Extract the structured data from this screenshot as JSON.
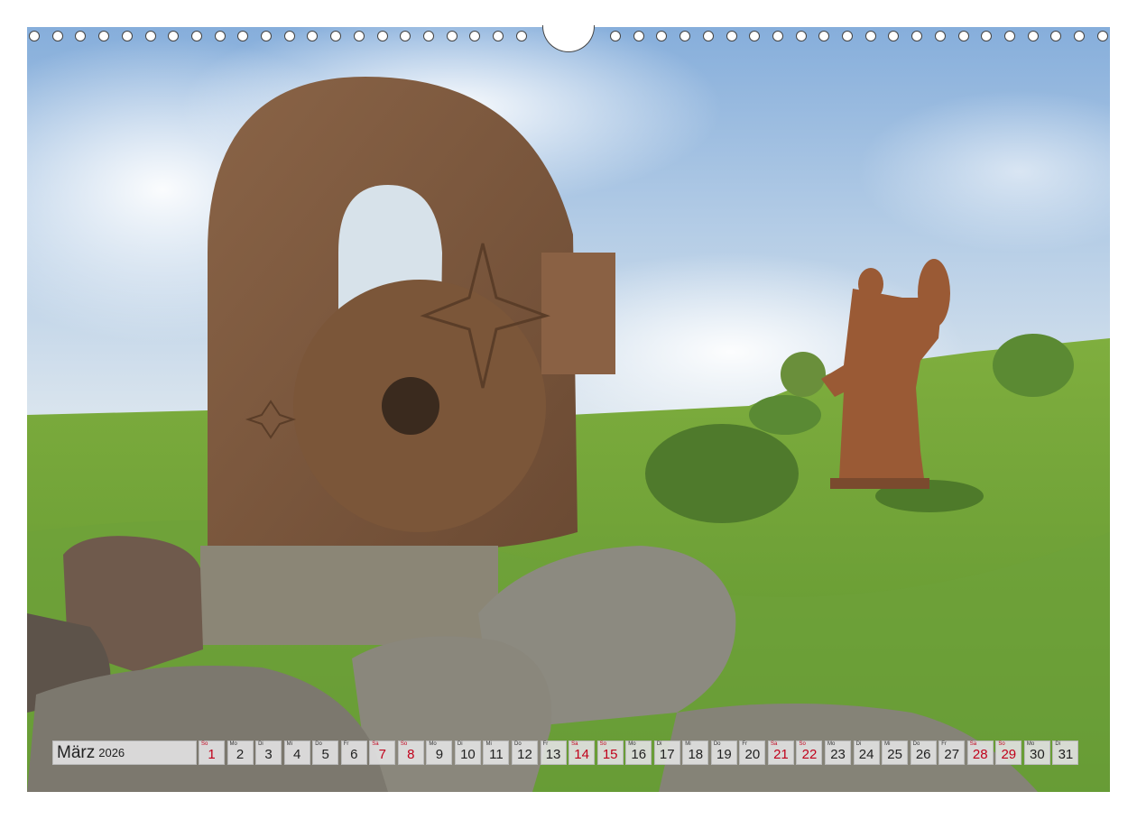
{
  "calendar": {
    "month": "März",
    "year": "2026",
    "weekend_color": "#c0001a",
    "days": [
      {
        "wd": "So",
        "n": "1",
        "we": true
      },
      {
        "wd": "Mo",
        "n": "2",
        "we": false
      },
      {
        "wd": "Di",
        "n": "3",
        "we": false
      },
      {
        "wd": "Mi",
        "n": "4",
        "we": false
      },
      {
        "wd": "Do",
        "n": "5",
        "we": false
      },
      {
        "wd": "Fr",
        "n": "6",
        "we": false
      },
      {
        "wd": "Sa",
        "n": "7",
        "we": true
      },
      {
        "wd": "So",
        "n": "8",
        "we": true
      },
      {
        "wd": "Mo",
        "n": "9",
        "we": false
      },
      {
        "wd": "Di",
        "n": "10",
        "we": false
      },
      {
        "wd": "Mi",
        "n": "11",
        "we": false
      },
      {
        "wd": "Do",
        "n": "12",
        "we": false
      },
      {
        "wd": "Fr",
        "n": "13",
        "we": false
      },
      {
        "wd": "Sa",
        "n": "14",
        "we": true
      },
      {
        "wd": "So",
        "n": "15",
        "we": true
      },
      {
        "wd": "Mo",
        "n": "16",
        "we": false
      },
      {
        "wd": "Di",
        "n": "17",
        "we": false
      },
      {
        "wd": "Mi",
        "n": "18",
        "we": false
      },
      {
        "wd": "Do",
        "n": "19",
        "we": false
      },
      {
        "wd": "Fr",
        "n": "20",
        "we": false
      },
      {
        "wd": "Sa",
        "n": "21",
        "we": true
      },
      {
        "wd": "So",
        "n": "22",
        "we": true
      },
      {
        "wd": "Mo",
        "n": "23",
        "we": false
      },
      {
        "wd": "Di",
        "n": "24",
        "we": false
      },
      {
        "wd": "Mi",
        "n": "25",
        "we": false
      },
      {
        "wd": "Do",
        "n": "26",
        "we": false
      },
      {
        "wd": "Fr",
        "n": "27",
        "we": false
      },
      {
        "wd": "Sa",
        "n": "28",
        "we": true
      },
      {
        "wd": "So",
        "n": "29",
        "we": true
      },
      {
        "wd": "Mo",
        "n": "30",
        "we": false
      },
      {
        "wd": "Di",
        "n": "31",
        "we": false
      }
    ]
  }
}
